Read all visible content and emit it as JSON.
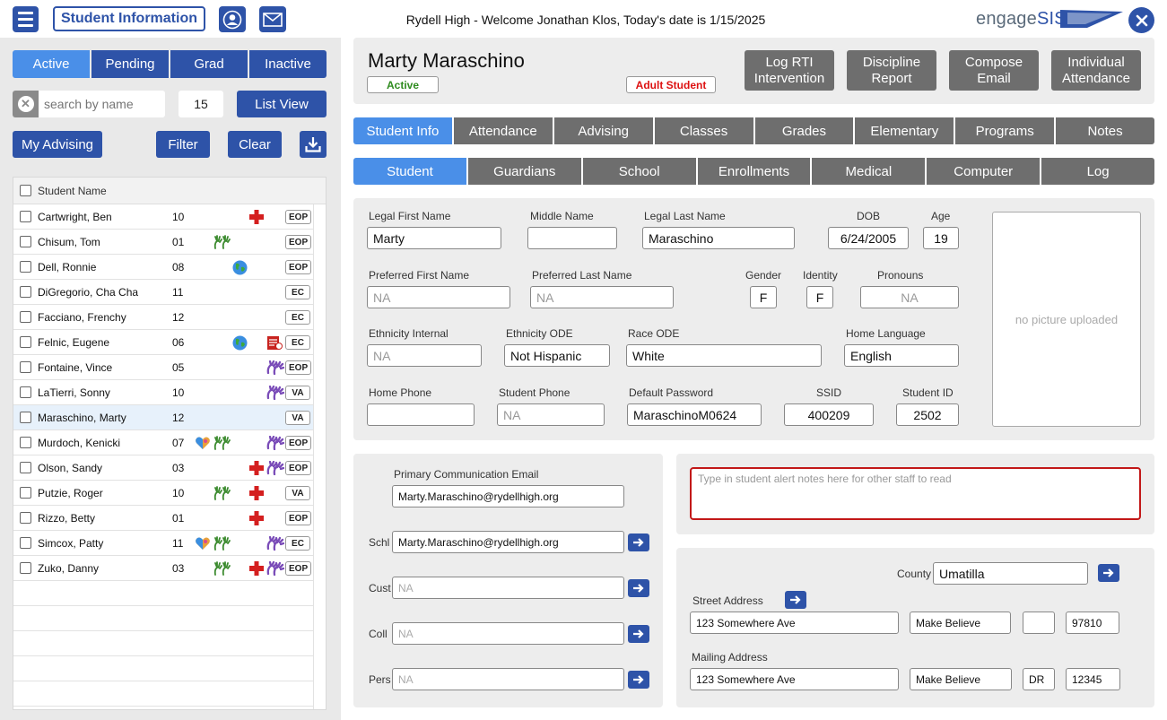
{
  "topbar": {
    "app_title": "Student Information",
    "welcome": "Rydell High - Welcome Jonathan Klos, Today's date is 1/15/2025",
    "logo_engage": "engage",
    "logo_sis": "SIS",
    "icons": [
      "menu-icon",
      "user-icon",
      "mail-icon",
      "close-icon"
    ],
    "accent_color": "#2e53a8"
  },
  "sidebar": {
    "status_tabs": [
      "Active",
      "Pending",
      "Grad",
      "Inactive"
    ],
    "active_status": "Active",
    "search_placeholder": "search by name",
    "count": "15",
    "list_view_label": "List View",
    "my_advising_label": "My Advising",
    "filter_label": "Filter",
    "clear_label": "Clear",
    "list_header": "Student Name",
    "students": [
      {
        "name": "Cartwright, Ben",
        "grade": "10",
        "icons": [
          "medical-icon"
        ],
        "badge": "EOP"
      },
      {
        "name": "Chisum, Tom",
        "grade": "01",
        "icons": [
          "hands-icon"
        ],
        "badge": "EOP"
      },
      {
        "name": "Dell, Ronnie",
        "grade": "08",
        "icons": [
          "globe-icon"
        ],
        "badge": "EOP"
      },
      {
        "name": "DiGregorio, Cha Cha",
        "grade": "11",
        "icons": [],
        "badge": "EC"
      },
      {
        "name": "Facciano, Frenchy",
        "grade": "12",
        "icons": [],
        "badge": "EC"
      },
      {
        "name": "Felnic, Eugene",
        "grade": "06",
        "icons": [
          "globe-icon",
          "document-icon"
        ],
        "badge": "EC"
      },
      {
        "name": "Fontaine, Vince",
        "grade": "05",
        "icons": [
          "purple-hands-icon"
        ],
        "badge": "EOP"
      },
      {
        "name": "LaTierri, Sonny",
        "grade": "10",
        "icons": [
          "purple-hands-icon"
        ],
        "badge": "VA"
      },
      {
        "name": "Maraschino, Marty",
        "grade": "12",
        "icons": [],
        "badge": "VA",
        "selected": true
      },
      {
        "name": "Murdoch, Kenicki",
        "grade": "07",
        "icons": [
          "heart-hands-icon",
          "hands-icon",
          "purple-hands-icon"
        ],
        "badge": "EOP"
      },
      {
        "name": "Olson, Sandy",
        "grade": "03",
        "icons": [
          "medical-icon",
          "purple-hands-icon"
        ],
        "badge": "EOP"
      },
      {
        "name": "Putzie, Roger",
        "grade": "10",
        "icons": [
          "hands-icon",
          "medical-icon"
        ],
        "badge": "VA"
      },
      {
        "name": "Rizzo, Betty",
        "grade": "01",
        "icons": [
          "medical-icon"
        ],
        "badge": "EOP"
      },
      {
        "name": "Simcox, Patty",
        "grade": "11",
        "icons": [
          "heart-hands-icon",
          "hands-icon",
          "purple-hands-icon"
        ],
        "badge": "EC"
      },
      {
        "name": "Zuko, Danny",
        "grade": "03",
        "icons": [
          "hands-icon",
          "medical-icon",
          "purple-hands-icon"
        ],
        "badge": "EOP"
      }
    ]
  },
  "header": {
    "student_name": "Marty Maraschino",
    "active_badge": "Active",
    "adult_badge": "Adult Student",
    "actions": [
      [
        "Log RTI",
        "Intervention"
      ],
      [
        "Discipline",
        "Report"
      ],
      [
        "Compose",
        "Email"
      ],
      [
        "Individual",
        "Attendance"
      ]
    ]
  },
  "tabs_primary": [
    "Student Info",
    "Attendance",
    "Advising",
    "Classes",
    "Grades",
    "Elementary",
    "Programs",
    "Notes"
  ],
  "tabs_secondary": [
    "Student",
    "Guardians",
    "School",
    "Enrollments",
    "Medical",
    "Computer",
    "Log"
  ],
  "info": {
    "labels": {
      "legal_first": "Legal First Name",
      "middle": "Middle Name",
      "legal_last": "Legal Last Name",
      "dob": "DOB",
      "age": "Age",
      "pref_first": "Preferred First Name",
      "pref_last": "Preferred Last Name",
      "gender": "Gender",
      "identity": "Identity",
      "pronouns": "Pronouns",
      "eth_internal": "Ethnicity Internal",
      "eth_ode": "Ethnicity ODE",
      "race_ode": "Race ODE",
      "home_lang": "Home Language",
      "home_phone": "Home Phone",
      "student_phone": "Student Phone",
      "default_password": "Default Password",
      "ssid": "SSID",
      "student_id": "Student ID"
    },
    "values": {
      "legal_first": "Marty",
      "middle": "",
      "legal_last": "Maraschino",
      "dob": "6/24/2005",
      "age": "19",
      "pref_first": "NA",
      "pref_last": "NA",
      "gender": "F",
      "identity": "F",
      "pronouns": "NA",
      "eth_internal": "NA",
      "eth_ode": "Not Hispanic",
      "race_ode": "White",
      "home_lang": "English",
      "home_phone": "",
      "student_phone": "NA",
      "default_password": "MaraschinoM0624",
      "ssid": "400209",
      "student_id": "2502"
    },
    "photo_text": "no picture uploaded"
  },
  "email": {
    "primary_label": "Primary Communication Email",
    "primary_value": "Marty.Maraschino@rydellhigh.org",
    "rows": [
      {
        "label": "Schl",
        "value": "Marty.Maraschino@rydellhigh.org",
        "placeholder": false
      },
      {
        "label": "Cust",
        "value": "NA",
        "placeholder": true
      },
      {
        "label": "Coll",
        "value": "NA",
        "placeholder": true
      },
      {
        "label": "Pers",
        "value": "NA",
        "placeholder": true
      }
    ]
  },
  "alert": {
    "placeholder": "Type in student alert notes here for other staff to read",
    "border_color": "#c21818"
  },
  "address": {
    "county_label": "County",
    "county_value": "Umatilla",
    "street_label": "Street Address",
    "street": "123 Somewhere Ave",
    "street_city": "Make Believe",
    "street_state": "",
    "street_zip": "97810",
    "mailing_label": "Mailing Address",
    "mailing": "123 Somewhere Ave",
    "mailing_city": "Make Believe",
    "mailing_state": "DR",
    "mailing_zip": "12345"
  }
}
